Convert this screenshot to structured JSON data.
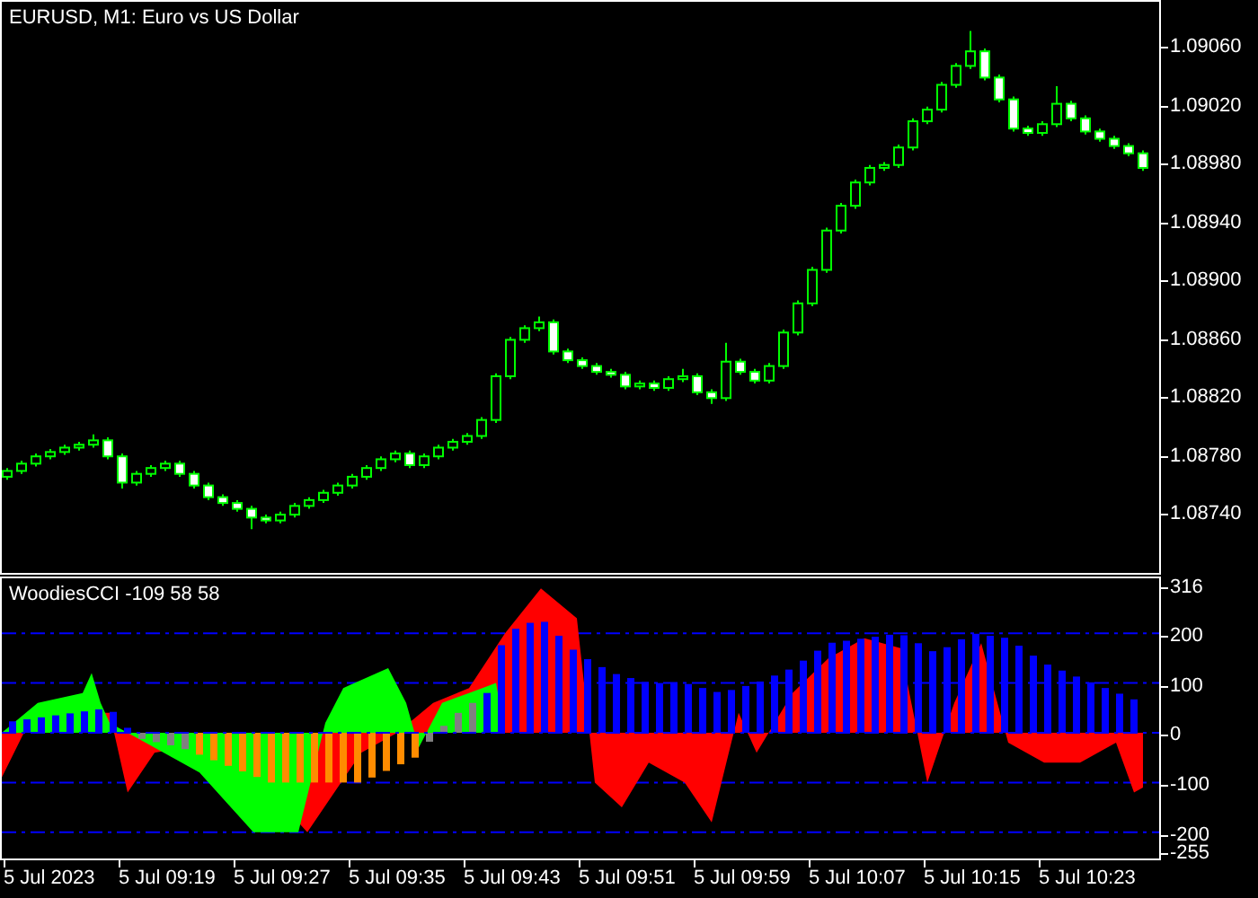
{
  "price_panel": {
    "title": "EURUSD, M1:  Euro vs US Dollar",
    "chart_data": {
      "type": "candlestick",
      "ylim": [
        1.087,
        1.09092
      ],
      "ohlc": [
        [
          1.08766,
          1.08772,
          1.08764,
          1.0877
        ],
        [
          1.0877,
          1.08777,
          1.08768,
          1.08775
        ],
        [
          1.08775,
          1.08782,
          1.08773,
          1.0878
        ],
        [
          1.0878,
          1.08785,
          1.08778,
          1.08783
        ],
        [
          1.08783,
          1.08788,
          1.08781,
          1.08786
        ],
        [
          1.08786,
          1.0879,
          1.08784,
          1.08788
        ],
        [
          1.08788,
          1.08795,
          1.08786,
          1.08791
        ],
        [
          1.08791,
          1.08793,
          1.08778,
          1.0878
        ],
        [
          1.0878,
          1.08782,
          1.08758,
          1.08762
        ],
        [
          1.08762,
          1.0877,
          1.0876,
          1.08768
        ],
        [
          1.08768,
          1.08774,
          1.08766,
          1.08772
        ],
        [
          1.08772,
          1.08777,
          1.0877,
          1.08775
        ],
        [
          1.08775,
          1.08777,
          1.08766,
          1.08768
        ],
        [
          1.08768,
          1.0877,
          1.08758,
          1.0876
        ],
        [
          1.0876,
          1.08762,
          1.0875,
          1.08752
        ],
        [
          1.08752,
          1.08754,
          1.08746,
          1.08748
        ],
        [
          1.08748,
          1.0875,
          1.08742,
          1.08744
        ],
        [
          1.08744,
          1.08746,
          1.0873,
          1.08738
        ],
        [
          1.08738,
          1.0874,
          1.08734,
          1.08736
        ],
        [
          1.08736,
          1.08742,
          1.08734,
          1.0874
        ],
        [
          1.0874,
          1.08748,
          1.08738,
          1.08746
        ],
        [
          1.08746,
          1.08752,
          1.08744,
          1.0875
        ],
        [
          1.0875,
          1.08757,
          1.08748,
          1.08755
        ],
        [
          1.08755,
          1.08762,
          1.08753,
          1.0876
        ],
        [
          1.0876,
          1.08768,
          1.08758,
          1.08766
        ],
        [
          1.08766,
          1.08774,
          1.08764,
          1.08772
        ],
        [
          1.08772,
          1.0878,
          1.0877,
          1.08778
        ],
        [
          1.08778,
          1.08784,
          1.08776,
          1.08782
        ],
        [
          1.08782,
          1.08784,
          1.08772,
          1.08774
        ],
        [
          1.08774,
          1.08782,
          1.08772,
          1.0878
        ],
        [
          1.0878,
          1.08788,
          1.08778,
          1.08786
        ],
        [
          1.08786,
          1.08792,
          1.08784,
          1.0879
        ],
        [
          1.0879,
          1.08796,
          1.08788,
          1.08794
        ],
        [
          1.08794,
          1.08807,
          1.08792,
          1.08805
        ],
        [
          1.08805,
          1.08837,
          1.08803,
          1.08835
        ],
        [
          1.08835,
          1.08862,
          1.08833,
          1.0886
        ],
        [
          1.0886,
          1.0887,
          1.08858,
          1.08868
        ],
        [
          1.08868,
          1.08876,
          1.08866,
          1.08872
        ],
        [
          1.08872,
          1.08874,
          1.0885,
          1.08852
        ],
        [
          1.08852,
          1.08854,
          1.08844,
          1.08846
        ],
        [
          1.08846,
          1.08848,
          1.0884,
          1.08842
        ],
        [
          1.08842,
          1.08844,
          1.08836,
          1.08838
        ],
        [
          1.08838,
          1.0884,
          1.08834,
          1.08836
        ],
        [
          1.08836,
          1.08838,
          1.08826,
          1.08828
        ],
        [
          1.08828,
          1.08832,
          1.08826,
          1.0883
        ],
        [
          1.0883,
          1.08832,
          1.08825,
          1.08827
        ],
        [
          1.08827,
          1.08835,
          1.08825,
          1.08833
        ],
        [
          1.08833,
          1.0884,
          1.08831,
          1.08835
        ],
        [
          1.08835,
          1.08837,
          1.08822,
          1.08824
        ],
        [
          1.08824,
          1.08826,
          1.08816,
          1.0882
        ],
        [
          1.0882,
          1.08858,
          1.08818,
          1.08845
        ],
        [
          1.08845,
          1.08847,
          1.08836,
          1.08838
        ],
        [
          1.08838,
          1.0884,
          1.0883,
          1.08832
        ],
        [
          1.08832,
          1.08844,
          1.0883,
          1.08842
        ],
        [
          1.08842,
          1.08867,
          1.0884,
          1.08865
        ],
        [
          1.08865,
          1.08887,
          1.08863,
          1.08885
        ],
        [
          1.08885,
          1.0891,
          1.08883,
          1.08908
        ],
        [
          1.08908,
          1.08937,
          1.08906,
          1.08935
        ],
        [
          1.08935,
          1.08954,
          1.08933,
          1.08952
        ],
        [
          1.08952,
          1.0897,
          1.0895,
          1.08968
        ],
        [
          1.08968,
          1.0898,
          1.08966,
          1.08978
        ],
        [
          1.08978,
          1.08982,
          1.08976,
          1.0898
        ],
        [
          1.0898,
          1.08994,
          1.08978,
          1.08992
        ],
        [
          1.08992,
          1.09012,
          1.0899,
          1.0901
        ],
        [
          1.0901,
          1.0902,
          1.09008,
          1.09018
        ],
        [
          1.09018,
          1.09037,
          1.09016,
          1.09035
        ],
        [
          1.09035,
          1.0905,
          1.09033,
          1.09048
        ],
        [
          1.09048,
          1.09072,
          1.09046,
          1.09058
        ],
        [
          1.09058,
          1.0906,
          1.09038,
          1.0904
        ],
        [
          1.0904,
          1.09042,
          1.09023,
          1.09025
        ],
        [
          1.09025,
          1.09027,
          1.09003,
          1.09005
        ],
        [
          1.09005,
          1.09007,
          1.09,
          1.09002
        ],
        [
          1.09002,
          1.0901,
          1.09,
          1.09008
        ],
        [
          1.09008,
          1.09034,
          1.09006,
          1.09022
        ],
        [
          1.09022,
          1.09024,
          1.0901,
          1.09012
        ],
        [
          1.09012,
          1.09014,
          1.09001,
          1.09003
        ],
        [
          1.09003,
          1.09005,
          1.08996,
          1.08998
        ],
        [
          1.08998,
          1.09,
          1.08991,
          1.08993
        ],
        [
          1.08993,
          1.08995,
          1.08986,
          1.08988
        ],
        [
          1.08988,
          1.0899,
          1.08976,
          1.08978
        ]
      ],
      "yticks": [
        {
          "value": 1.0906,
          "label": "1.09060"
        },
        {
          "value": 1.0902,
          "label": "1.09020"
        },
        {
          "value": 1.0898,
          "label": "1.08980"
        },
        {
          "value": 1.0894,
          "label": "1.08940"
        },
        {
          "value": 1.089,
          "label": "1.08900"
        },
        {
          "value": 1.0886,
          "label": "1.08860"
        },
        {
          "value": 1.0882,
          "label": "1.08820"
        },
        {
          "value": 1.0878,
          "label": "1.08780"
        },
        {
          "value": 1.0874,
          "label": "1.08740"
        }
      ]
    }
  },
  "indicator_panel": {
    "title": "WoodiesCCI -109 58 58",
    "axis_labels": [
      "316",
      "200",
      "100",
      "0",
      "-100",
      "-200",
      "-255"
    ]
  },
  "time_axis": {
    "labels": [
      "5 Jul 2023",
      "5 Jul 09:19",
      "5 Jul 09:27",
      "5 Jul 09:35",
      "5 Jul 09:43",
      "5 Jul 09:51",
      "5 Jul 09:59",
      "5 Jul 10:07",
      "5 Jul 10:15",
      "5 Jul 10:23"
    ]
  }
}
